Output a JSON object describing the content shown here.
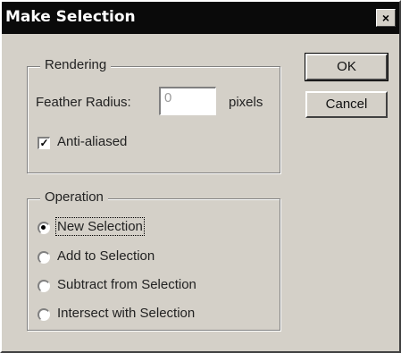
{
  "window": {
    "title": "Make Selection",
    "close_glyph": "×"
  },
  "rendering": {
    "legend": "Rendering",
    "feather_label": "Feather Radius:",
    "feather_value": "0",
    "feather_unit": "pixels",
    "antialiased_label": "Anti-aliased",
    "antialiased_checked": true
  },
  "operation": {
    "legend": "Operation",
    "options": [
      {
        "label": "New Selection",
        "selected": true
      },
      {
        "label": "Add to Selection",
        "selected": false
      },
      {
        "label": "Subtract from Selection",
        "selected": false
      },
      {
        "label": "Intersect with Selection",
        "selected": false
      }
    ]
  },
  "buttons": {
    "ok": "OK",
    "cancel": "Cancel"
  }
}
